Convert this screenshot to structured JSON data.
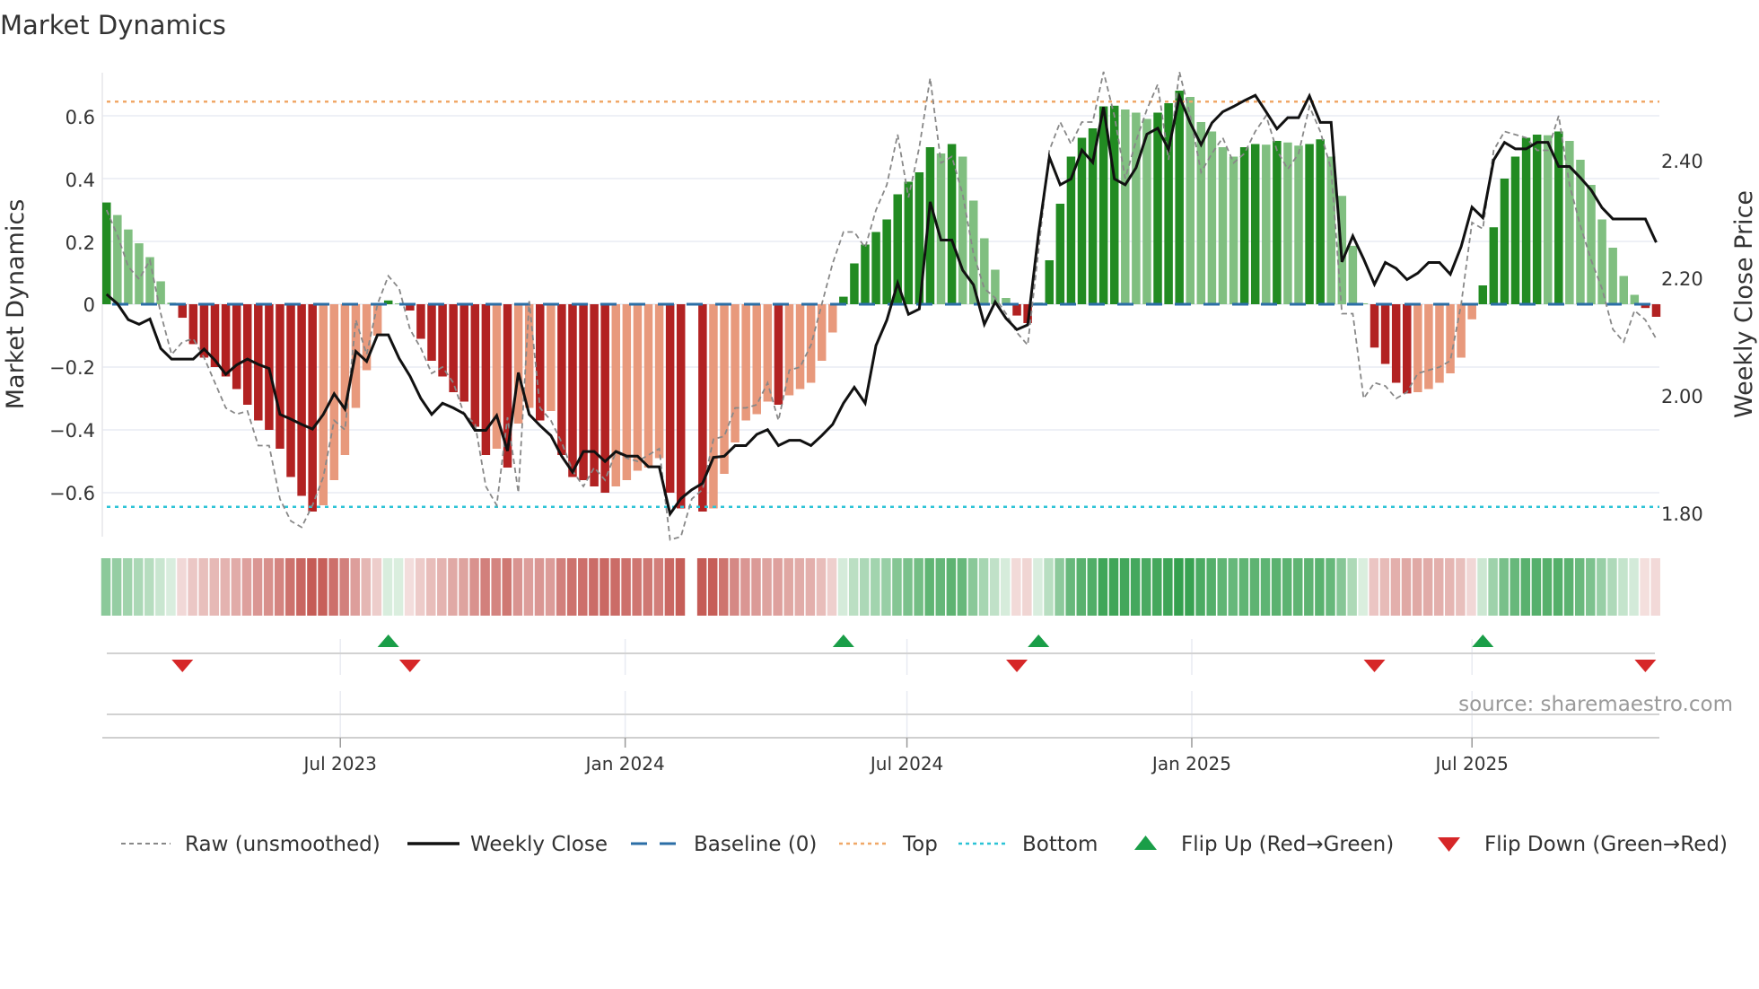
{
  "chart_data": {
    "type": "bar",
    "title": "Market Dynamics",
    "ylabel": "Market Dynamics",
    "y2label": "Weekly Close Price",
    "ylim": [
      -0.73,
      0.75
    ],
    "y2lim": [
      1.77,
      2.53
    ],
    "yticks": [
      "0.6",
      "0.4",
      "0.2",
      "0",
      "−0.2",
      "−0.4",
      "−0.6"
    ],
    "y2ticks": [
      "2.40",
      "2.20",
      "2.00",
      "1.80"
    ],
    "xticks": [
      {
        "label": "Jul 2023",
        "date": "2023-07-01"
      },
      {
        "label": "Jan 2024",
        "date": "2024-01-01"
      },
      {
        "label": "Jul 2024",
        "date": "2024-07-01"
      },
      {
        "label": "Jan 2025",
        "date": "2025-01-01"
      },
      {
        "label": "Jul 2025",
        "date": "2025-07-01"
      }
    ],
    "x_start": "2023-01-31",
    "x_step_days": 7,
    "top": 0.645,
    "bottom": -0.645,
    "baseline": 0,
    "series": [
      {
        "name": "Market Dynamics",
        "type": "bar",
        "values": [
          0.324,
          0.284,
          0.238,
          0.194,
          0.15,
          0.073,
          0.005,
          -0.043,
          -0.127,
          -0.17,
          -0.2,
          -0.23,
          -0.27,
          -0.32,
          -0.37,
          -0.4,
          -0.46,
          -0.55,
          -0.61,
          -0.66,
          -0.64,
          -0.56,
          -0.48,
          -0.33,
          -0.21,
          -0.1,
          0.012,
          0.003,
          -0.02,
          -0.11,
          -0.18,
          -0.23,
          -0.28,
          -0.31,
          -0.39,
          -0.48,
          -0.46,
          -0.52,
          -0.38,
          -0.33,
          -0.37,
          -0.34,
          -0.48,
          -0.55,
          -0.56,
          -0.58,
          -0.6,
          -0.58,
          -0.56,
          -0.53,
          -0.52,
          -0.49,
          -0.6,
          -0.65,
          null,
          -0.66,
          -0.65,
          -0.54,
          -0.44,
          -0.37,
          -0.35,
          -0.31,
          -0.32,
          -0.29,
          -0.27,
          -0.25,
          -0.18,
          -0.09,
          0.024,
          0.13,
          0.19,
          0.23,
          0.27,
          0.35,
          0.39,
          0.42,
          0.5,
          0.48,
          0.51,
          0.47,
          0.33,
          0.21,
          0.11,
          0.02,
          -0.036,
          -0.06,
          0.005,
          0.14,
          0.32,
          0.47,
          0.53,
          0.56,
          0.63,
          0.632,
          0.62,
          0.61,
          0.59,
          0.61,
          0.64,
          0.68,
          0.66,
          0.58,
          0.55,
          0.5,
          0.47,
          0.5,
          0.51,
          0.508,
          0.52,
          0.515,
          0.505,
          0.51,
          0.525,
          0.47,
          0.345,
          0.186,
          0.003,
          -0.138,
          -0.19,
          -0.25,
          -0.284,
          -0.28,
          -0.27,
          -0.25,
          -0.22,
          -0.17,
          -0.048,
          0.06,
          0.245,
          0.4,
          0.47,
          0.53,
          0.54,
          0.538,
          0.55,
          0.52,
          0.46,
          0.38,
          0.27,
          0.18,
          0.09,
          0.03,
          -0.012,
          -0.04
        ]
      },
      {
        "name": "Raw (unsmoothed)",
        "type": "line",
        "values": [
          0.3,
          0.22,
          0.12,
          0.08,
          0.14,
          -0.03,
          -0.16,
          -0.12,
          -0.11,
          -0.17,
          -0.25,
          -0.33,
          -0.35,
          -0.34,
          -0.45,
          -0.45,
          -0.62,
          -0.69,
          -0.71,
          -0.64,
          -0.55,
          -0.37,
          -0.4,
          -0.05,
          -0.16,
          0.0,
          0.09,
          0.05,
          -0.08,
          -0.14,
          -0.22,
          -0.2,
          -0.25,
          -0.35,
          -0.38,
          -0.58,
          -0.64,
          -0.36,
          -0.6,
          0.01,
          -0.33,
          -0.37,
          -0.44,
          -0.53,
          -0.58,
          -0.52,
          -0.56,
          -0.47,
          -0.49,
          -0.5,
          -0.48,
          -0.46,
          -0.75,
          -0.74,
          -0.62,
          -0.59,
          -0.43,
          -0.42,
          -0.33,
          -0.33,
          -0.32,
          -0.25,
          -0.37,
          -0.21,
          -0.2,
          -0.13,
          0.0,
          0.13,
          0.23,
          0.23,
          0.18,
          0.3,
          0.38,
          0.54,
          0.34,
          0.5,
          0.72,
          0.45,
          0.47,
          0.35,
          0.16,
          0.05,
          0.02,
          -0.03,
          -0.09,
          -0.13,
          0.17,
          0.49,
          0.58,
          0.51,
          0.58,
          0.58,
          0.74,
          0.6,
          0.4,
          0.52,
          0.62,
          0.7,
          0.46,
          0.74,
          0.6,
          0.42,
          0.48,
          0.53,
          0.45,
          0.48,
          0.55,
          0.6,
          0.49,
          0.43,
          0.48,
          0.63,
          0.55,
          0.43,
          -0.03,
          -0.03,
          -0.3,
          -0.25,
          -0.26,
          -0.3,
          -0.28,
          -0.22,
          -0.21,
          -0.2,
          -0.18,
          0.0,
          0.26,
          0.24,
          0.49,
          0.55,
          0.54,
          0.53,
          0.49,
          0.49,
          0.6,
          0.38,
          0.25,
          0.14,
          0.05,
          -0.08,
          -0.12,
          -0.02,
          -0.05,
          -0.11
        ]
      },
      {
        "name": "Weekly Close",
        "type": "line",
        "axis": "right",
        "values": [
          2.173,
          2.157,
          2.13,
          2.122,
          2.131,
          2.081,
          2.063,
          2.063,
          2.063,
          2.08,
          2.061,
          2.037,
          2.053,
          2.063,
          2.054,
          2.047,
          1.969,
          1.961,
          1.952,
          1.944,
          1.969,
          2.004,
          1.978,
          2.076,
          2.059,
          2.104,
          2.104,
          2.064,
          2.034,
          1.996,
          1.969,
          1.988,
          1.98,
          1.97,
          1.942,
          1.942,
          1.967,
          1.907,
          2.04,
          1.969,
          1.95,
          1.933,
          1.898,
          1.871,
          1.906,
          1.906,
          1.889,
          1.906,
          1.898,
          1.898,
          1.88,
          1.88,
          1.8,
          1.826,
          1.841,
          1.852,
          1.896,
          1.898,
          1.916,
          1.916,
          1.935,
          1.943,
          1.916,
          1.925,
          1.925,
          1.916,
          1.933,
          1.952,
          1.988,
          2.015,
          1.988,
          2.086,
          2.129,
          2.192,
          2.139,
          2.148,
          2.33,
          2.265,
          2.265,
          2.214,
          2.189,
          2.122,
          2.16,
          2.132,
          2.113,
          2.121,
          2.276,
          2.406,
          2.359,
          2.369,
          2.418,
          2.397,
          2.491,
          2.369,
          2.359,
          2.388,
          2.445,
          2.455,
          2.419,
          2.509,
          2.464,
          2.427,
          2.464,
          2.483,
          2.492,
          2.502,
          2.511,
          2.483,
          2.454,
          2.473,
          2.473,
          2.51,
          2.465,
          2.465,
          2.228,
          2.272,
          2.233,
          2.19,
          2.227,
          2.217,
          2.198,
          2.209,
          2.227,
          2.227,
          2.207,
          2.254,
          2.321,
          2.303,
          2.401,
          2.431,
          2.42,
          2.42,
          2.431,
          2.431,
          2.39,
          2.39,
          2.371,
          2.35,
          2.32,
          2.301,
          2.301,
          2.301,
          2.301,
          2.261
        ]
      }
    ],
    "flip_up_weeks": [
      26,
      68,
      86,
      127
    ],
    "flip_down_weeks": [
      7,
      28,
      84,
      117,
      142
    ],
    "legend": {
      "placement": "bottom",
      "items": [
        "Raw (unsmoothed)",
        "Weekly Close",
        "Baseline (0)",
        "Top",
        "Bottom",
        "Flip Up (Red→Green)",
        "Flip Down (Green→Red)"
      ]
    },
    "colors": {
      "green_dark": "#228b22",
      "green_light": "#80bf80",
      "red_dark": "#b22222",
      "red_light": "#e8997c",
      "top": "#f0a868",
      "bottom": "#2cc3d6",
      "baseline": "#2b6ea6",
      "close": "#111111",
      "raw": "#888888",
      "flip_up": "#1a9e48",
      "flip_down": "#d62728"
    }
  },
  "source": "source: sharemaestro.com"
}
